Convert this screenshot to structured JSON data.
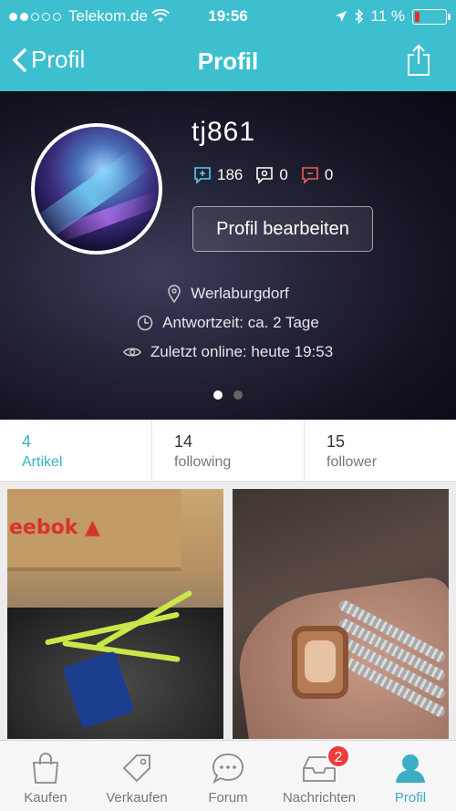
{
  "status_bar": {
    "carrier": "Telekom.de",
    "time": "19:56",
    "battery_percent": "11 %",
    "signal_bars": 2
  },
  "nav": {
    "back_label": "Profil",
    "title": "Profil"
  },
  "profile": {
    "username": "tj861",
    "stats": {
      "positive": "186",
      "neutral": "0",
      "negative": "0"
    },
    "edit_button": "Profil bearbeiten",
    "location": "Werlaburgdorf",
    "response_time": "Antwortzeit: ca. 2 Tage",
    "last_online": "Zuletzt online: heute 19:53"
  },
  "counts": [
    {
      "number": "4",
      "label": "Artikel"
    },
    {
      "number": "14",
      "label": "following"
    },
    {
      "number": "15",
      "label": "follower"
    }
  ],
  "tabs": [
    {
      "label": "Kaufen",
      "icon": "bag-icon"
    },
    {
      "label": "Verkaufen",
      "icon": "tag-icon"
    },
    {
      "label": "Forum",
      "icon": "chat-icon"
    },
    {
      "label": "Nachrichten",
      "icon": "inbox-icon",
      "badge": "2"
    },
    {
      "label": "Profil",
      "icon": "person-icon"
    }
  ],
  "colors": {
    "accent": "#3dbfd0",
    "active_tab": "#3aafc4",
    "badge": "#ef3b3b"
  }
}
